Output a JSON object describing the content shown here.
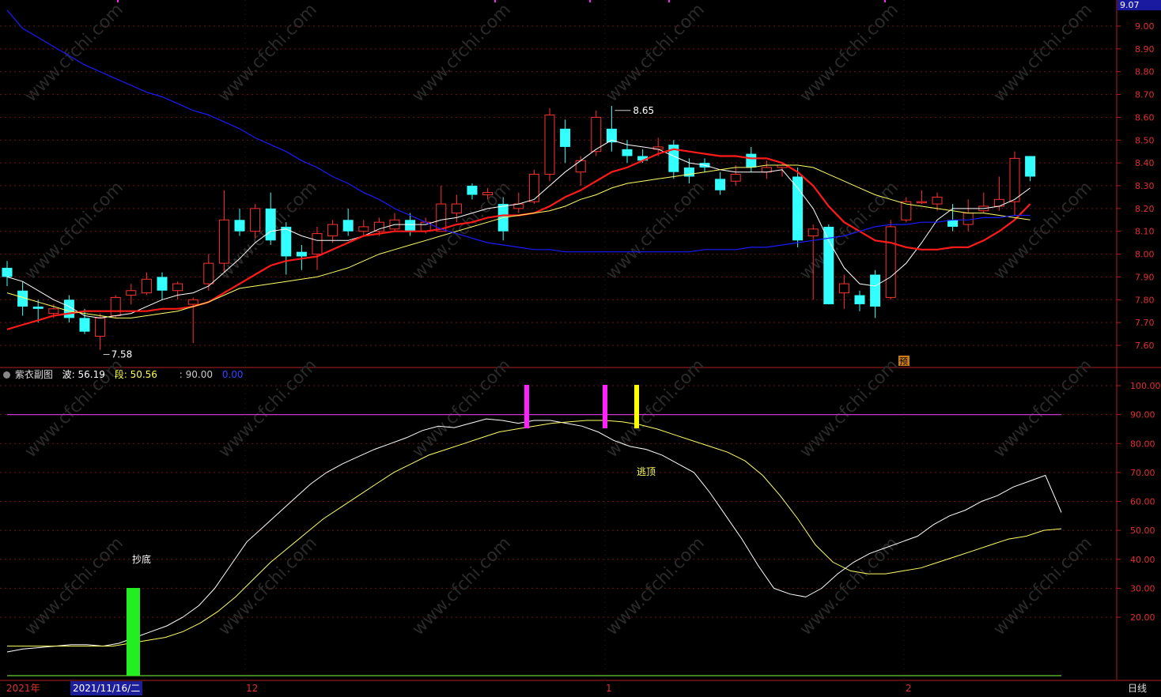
{
  "chart_data": [
    {
      "type": "candlestick",
      "ylim": [
        7.52,
        9.07
      ],
      "yticks": [
        7.6,
        7.7,
        7.8,
        7.9,
        8.0,
        8.1,
        8.2,
        8.3,
        8.4,
        8.5,
        8.6,
        8.7,
        8.8,
        8.9,
        9.0
      ],
      "ytick_labels": [
        "7.60",
        "7.70",
        "7.80",
        "7.90",
        "8.00",
        "8.10",
        "8.20",
        "8.30",
        "8.40",
        "8.50",
        "8.60",
        "8.70",
        "8.80",
        "8.90",
        "9.00"
      ],
      "ymax_label": "9.07",
      "annotations": {
        "high_label": "8.65",
        "low_label": "7.58",
        "mark_label": "预"
      },
      "candles": [
        [
          7.94,
          7.9,
          7.97,
          7.86
        ],
        [
          7.84,
          7.77,
          7.88,
          7.73
        ],
        [
          7.77,
          7.76,
          7.8,
          7.7
        ],
        [
          7.74,
          7.76,
          7.78,
          7.72
        ],
        [
          7.8,
          7.72,
          7.82,
          7.7
        ],
        [
          7.72,
          7.66,
          7.76,
          7.65
        ],
        [
          7.64,
          7.72,
          7.74,
          7.58
        ],
        [
          7.73,
          7.81,
          7.82,
          7.72
        ],
        [
          7.82,
          7.84,
          7.87,
          7.78
        ],
        [
          7.83,
          7.89,
          7.92,
          7.82
        ],
        [
          7.9,
          7.84,
          7.92,
          7.8
        ],
        [
          7.84,
          7.87,
          7.88,
          7.8
        ],
        [
          7.78,
          7.8,
          7.81,
          7.61
        ],
        [
          7.87,
          7.96,
          8.0,
          7.84
        ],
        [
          7.96,
          8.15,
          8.28,
          7.92
        ],
        [
          8.15,
          8.1,
          8.2,
          8.08
        ],
        [
          8.1,
          8.2,
          8.22,
          8.07
        ],
        [
          8.2,
          8.06,
          8.27,
          8.04
        ],
        [
          8.12,
          7.99,
          8.14,
          7.91
        ],
        [
          8.01,
          7.99,
          8.04,
          7.93
        ],
        [
          8.0,
          8.09,
          8.12,
          7.93
        ],
        [
          8.08,
          8.13,
          8.15,
          8.05
        ],
        [
          8.15,
          8.1,
          8.2,
          8.08
        ],
        [
          8.1,
          8.12,
          8.15,
          8.08
        ],
        [
          8.1,
          8.14,
          8.16,
          8.08
        ],
        [
          8.11,
          8.15,
          8.18,
          8.1
        ],
        [
          8.15,
          8.1,
          8.18,
          8.08
        ],
        [
          8.1,
          8.14,
          8.16,
          8.09
        ],
        [
          8.1,
          8.22,
          8.3,
          8.1
        ],
        [
          8.18,
          8.22,
          8.26,
          8.14
        ],
        [
          8.3,
          8.26,
          8.31,
          8.24
        ],
        [
          8.26,
          8.27,
          8.29,
          8.24
        ],
        [
          8.22,
          8.1,
          8.25,
          8.06
        ],
        [
          8.2,
          8.22,
          8.27,
          8.18
        ],
        [
          8.23,
          8.35,
          8.37,
          8.22
        ],
        [
          8.35,
          8.61,
          8.64,
          8.32
        ],
        [
          8.55,
          8.47,
          8.59,
          8.4
        ],
        [
          8.36,
          8.41,
          8.43,
          8.3
        ],
        [
          8.45,
          8.6,
          8.63,
          8.43
        ],
        [
          8.55,
          8.49,
          8.65,
          8.45
        ],
        [
          8.46,
          8.43,
          8.5,
          8.4
        ],
        [
          8.43,
          8.41,
          8.46,
          8.4
        ],
        [
          8.46,
          8.47,
          8.51,
          8.43
        ],
        [
          8.48,
          8.36,
          8.5,
          8.33
        ],
        [
          8.38,
          8.34,
          8.42,
          8.31
        ],
        [
          8.4,
          8.38,
          8.42,
          8.36
        ],
        [
          8.33,
          8.28,
          8.36,
          8.26
        ],
        [
          8.32,
          8.35,
          8.39,
          8.3
        ],
        [
          8.44,
          8.38,
          8.47,
          8.36
        ],
        [
          8.36,
          8.38,
          8.41,
          8.33
        ],
        [
          8.38,
          8.39,
          8.4,
          8.34
        ],
        [
          8.34,
          8.06,
          8.38,
          8.03
        ],
        [
          8.08,
          8.11,
          8.13,
          7.8
        ],
        [
          8.12,
          7.78,
          8.13,
          7.78
        ],
        [
          7.83,
          7.87,
          7.91,
          7.76
        ],
        [
          7.82,
          7.78,
          7.84,
          7.75
        ],
        [
          7.91,
          7.77,
          7.93,
          7.72
        ],
        [
          7.81,
          8.12,
          8.15,
          7.8
        ],
        [
          8.15,
          8.23,
          8.25,
          8.14
        ],
        [
          8.23,
          8.23,
          8.28,
          8.22
        ],
        [
          8.22,
          8.25,
          8.27,
          8.19
        ],
        [
          8.15,
          8.12,
          8.22,
          8.1
        ],
        [
          8.13,
          8.18,
          8.24,
          8.1
        ],
        [
          8.19,
          8.21,
          8.27,
          8.18
        ],
        [
          8.21,
          8.24,
          8.34,
          8.19
        ],
        [
          8.23,
          8.42,
          8.45,
          8.17
        ],
        [
          8.43,
          8.34,
          8.43,
          8.32
        ]
      ],
      "series": [
        {
          "name": "MA5",
          "color": "#ffffff",
          "values": [
            7.9,
            7.88,
            7.84,
            7.8,
            7.77,
            7.73,
            7.72,
            7.73,
            7.74,
            7.77,
            7.8,
            7.82,
            7.83,
            7.86,
            7.92,
            7.98,
            8.05,
            8.1,
            8.11,
            8.08,
            8.06,
            8.06,
            8.06,
            8.08,
            8.11,
            8.13,
            8.13,
            8.13,
            8.15,
            8.16,
            8.18,
            8.2,
            8.21,
            8.22,
            8.24,
            8.3,
            8.36,
            8.41,
            8.46,
            8.5,
            8.48,
            8.47,
            8.46,
            8.43,
            8.4,
            8.39,
            8.37,
            8.36,
            8.36,
            8.36,
            8.37,
            8.29,
            8.2,
            8.06,
            7.94,
            7.87,
            7.86,
            7.9,
            7.96,
            8.05,
            8.15,
            8.2,
            8.2,
            8.2,
            8.21,
            8.24,
            8.29
          ]
        },
        {
          "name": "MA10",
          "color": "#ff1a1a",
          "values": [
            7.67,
            7.69,
            7.71,
            7.73,
            7.74,
            7.75,
            7.75,
            7.75,
            7.75,
            7.75,
            7.76,
            7.76,
            7.77,
            7.79,
            7.83,
            7.87,
            7.91,
            7.95,
            7.97,
            7.98,
            7.99,
            8.02,
            8.05,
            8.08,
            8.09,
            8.1,
            8.1,
            8.1,
            8.11,
            8.13,
            8.14,
            8.16,
            8.17,
            8.17,
            8.18,
            8.21,
            8.25,
            8.28,
            8.32,
            8.36,
            8.38,
            8.41,
            8.44,
            8.46,
            8.45,
            8.44,
            8.43,
            8.43,
            8.42,
            8.42,
            8.4,
            8.36,
            8.3,
            8.21,
            8.14,
            8.1,
            8.06,
            8.05,
            8.03,
            8.02,
            8.02,
            8.03,
            8.03,
            8.06,
            8.1,
            8.15,
            8.22
          ]
        },
        {
          "name": "MA20",
          "color": "#ffff66",
          "values": [
            7.83,
            7.81,
            7.79,
            7.77,
            7.75,
            7.74,
            7.73,
            7.72,
            7.72,
            7.73,
            7.74,
            7.75,
            7.77,
            7.79,
            7.82,
            7.85,
            7.86,
            7.87,
            7.88,
            7.89,
            7.9,
            7.92,
            7.94,
            7.97,
            8.0,
            8.02,
            8.04,
            8.06,
            8.08,
            8.1,
            8.12,
            8.14,
            8.16,
            8.17,
            8.18,
            8.19,
            8.21,
            8.24,
            8.26,
            8.29,
            8.31,
            8.32,
            8.33,
            8.34,
            8.35,
            8.36,
            8.37,
            8.38,
            8.38,
            8.39,
            8.39,
            8.39,
            8.38,
            8.35,
            8.32,
            8.29,
            8.26,
            8.24,
            8.22,
            8.21,
            8.2,
            8.19,
            8.18,
            8.18,
            8.17,
            8.16,
            8.15
          ]
        },
        {
          "name": "MA60",
          "color": "#1a1aff",
          "values": [
            9.07,
            8.99,
            8.95,
            8.91,
            8.87,
            8.83,
            8.8,
            8.77,
            8.74,
            8.71,
            8.69,
            8.66,
            8.63,
            8.61,
            8.58,
            8.55,
            8.51,
            8.48,
            8.45,
            8.41,
            8.38,
            8.34,
            8.31,
            8.27,
            8.24,
            8.2,
            8.17,
            8.14,
            8.11,
            8.09,
            8.07,
            8.05,
            8.04,
            8.03,
            8.02,
            8.02,
            8.01,
            8.01,
            8.01,
            8.01,
            8.01,
            8.01,
            8.01,
            8.01,
            8.01,
            8.02,
            8.02,
            8.02,
            8.03,
            8.03,
            8.04,
            8.05,
            8.06,
            8.07,
            8.08,
            8.1,
            8.12,
            8.13,
            8.13,
            8.14,
            8.14,
            8.15,
            8.15,
            8.16,
            8.16,
            8.17,
            8.17
          ]
        }
      ]
    },
    {
      "type": "line",
      "title": "紫衣副图",
      "ylim": [
        0,
        105
      ],
      "yticks": [
        20,
        30,
        40,
        50,
        60,
        70,
        80,
        90,
        100
      ],
      "ytick_labels": [
        "20.00",
        "30.00",
        "40.00",
        "50.00",
        "60.00",
        "70.00",
        "80.00",
        "90.00",
        "100.00"
      ],
      "series": [
        {
          "name": "波",
          "color": "#ffffff",
          "values": [
            8,
            9,
            9.5,
            10,
            10.5,
            10.5,
            10,
            11,
            13,
            15,
            17,
            20,
            24,
            30,
            38,
            46,
            51,
            56,
            61,
            66,
            70,
            73,
            75.5,
            78,
            80,
            82,
            84.5,
            86,
            85.5,
            87,
            88.5,
            88,
            87,
            88,
            88,
            87,
            86,
            84,
            81,
            79,
            78,
            76,
            73,
            70,
            63,
            55,
            47,
            38,
            30,
            28,
            27,
            30,
            35,
            39,
            42,
            44,
            46,
            48,
            52,
            55,
            57,
            60,
            62,
            65,
            67,
            69,
            56.19
          ]
        },
        {
          "name": "段",
          "color": "#ffff66",
          "values": [
            10,
            10,
            10,
            10,
            10,
            10,
            10,
            11,
            12,
            13,
            15,
            18,
            22,
            27,
            33,
            39,
            44,
            49,
            54,
            58,
            62,
            66,
            70,
            73,
            76,
            78,
            80,
            82,
            84,
            85,
            86,
            87,
            87.5,
            88,
            88,
            87.5,
            86.5,
            85,
            83,
            81,
            79,
            77,
            74,
            69,
            62,
            54,
            45,
            39,
            36,
            35,
            35,
            36,
            37,
            39,
            41,
            43,
            45,
            47,
            48,
            50,
            50.56
          ]
        }
      ],
      "horizontal_lines": [
        {
          "value": 90,
          "color": "#cc33cc"
        },
        {
          "value": 0,
          "color": "#66cc33"
        }
      ],
      "legend": {
        "title": "紫衣副图",
        "wave_label": "波: 56.19",
        "segment_label": "段: 50.56",
        "level_label": ": 90.00",
        "zero_label": "0.00"
      },
      "signals": {
        "bottom_label": "抄底",
        "top_label": "逃顶"
      }
    }
  ],
  "time_axis": {
    "labels": [
      "2021年",
      "2021/11/16/二",
      "12",
      "1",
      "2"
    ],
    "period_button": "日线"
  },
  "watermark": "www.cfchi.com"
}
